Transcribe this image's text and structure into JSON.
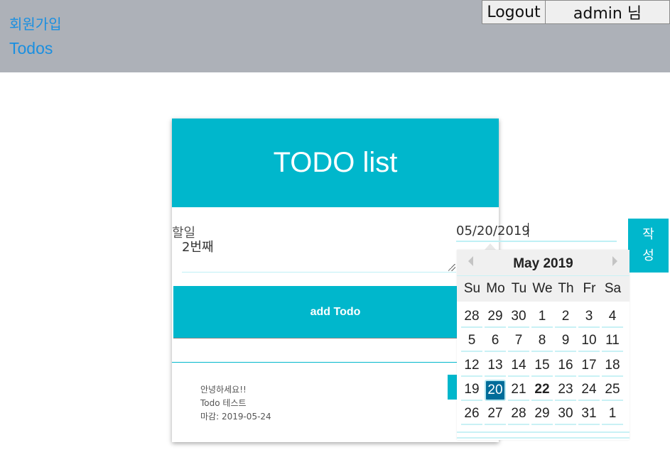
{
  "nav": {
    "signup": "회원가입",
    "todos": "Todos"
  },
  "header": {
    "logout": "Logout",
    "user": "admin 님"
  },
  "card": {
    "title": "TODO list"
  },
  "form": {
    "todo_label": "할일",
    "todo_value": "2번째",
    "date_value": "05/20/2019",
    "write_button": "작\n성",
    "add_button": "add Todo"
  },
  "todo_item": {
    "line1": "안녕하세요!!",
    "line2": "Todo 테스트",
    "line3": "마감: 2019-05-24"
  },
  "datepicker": {
    "month_title": "May 2019",
    "weekdays": [
      "Su",
      "Mo",
      "Tu",
      "We",
      "Th",
      "Fr",
      "Sa"
    ],
    "weeks": [
      [
        "28",
        "29",
        "30",
        "1",
        "2",
        "3",
        "4"
      ],
      [
        "5",
        "6",
        "7",
        "8",
        "9",
        "10",
        "11"
      ],
      [
        "12",
        "13",
        "14",
        "15",
        "16",
        "17",
        "18"
      ],
      [
        "19",
        "20",
        "21",
        "22",
        "23",
        "24",
        "25"
      ],
      [
        "26",
        "27",
        "28",
        "29",
        "30",
        "31",
        "1"
      ]
    ],
    "selected": "20",
    "today": "22"
  }
}
